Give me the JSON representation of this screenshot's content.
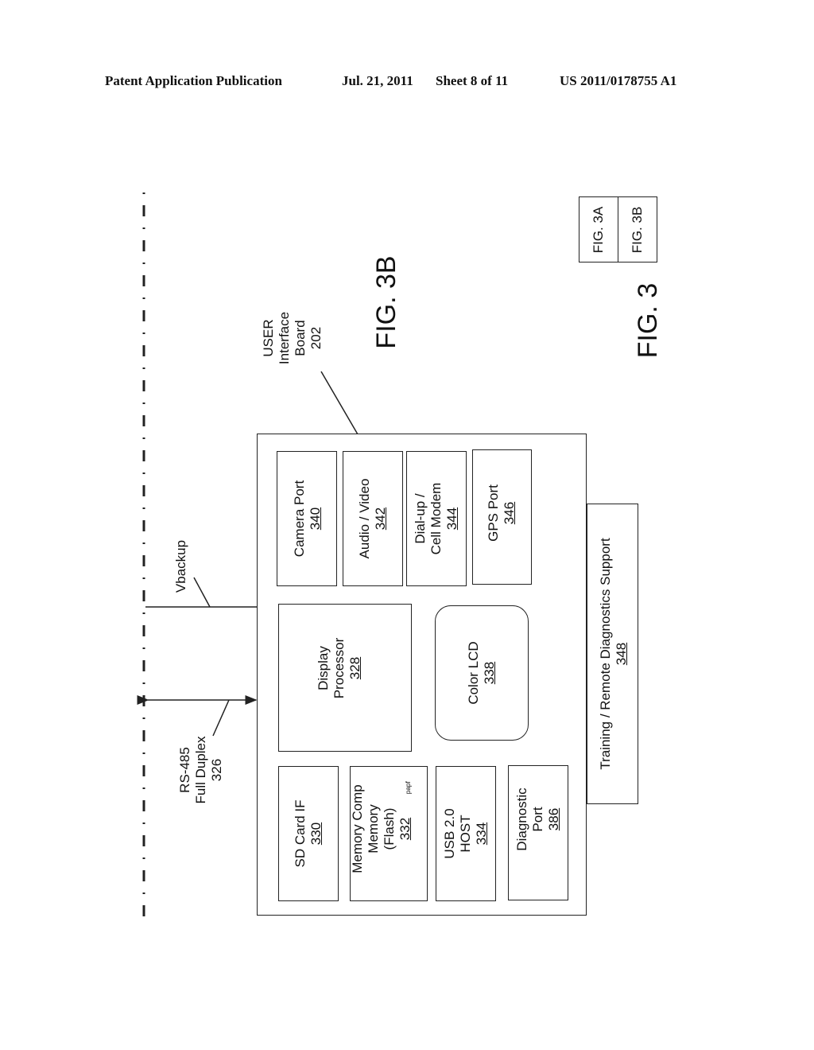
{
  "header": {
    "publication": "Patent Application Publication",
    "date": "Jul. 21, 2011",
    "sheet": "Sheet 8 of 11",
    "number": "US 2011/0178755 A1"
  },
  "figure": {
    "title": "FIG. 3B",
    "overall_title": "FIG. 3",
    "key": [
      "FIG. 3A",
      "FIG. 3B"
    ]
  },
  "board": {
    "label_lines": [
      "USER",
      "Interface",
      "Board",
      "202"
    ]
  },
  "signals": {
    "vbackup": "Vbackup",
    "rs485_lines": [
      "RS-485",
      "Full Duplex",
      "326"
    ]
  },
  "blocks": {
    "camera": {
      "name": "Camera Port",
      "ref": "340"
    },
    "audio": {
      "name": "Audio / Video",
      "ref": "342"
    },
    "modem": {
      "name1": "Dial-up /",
      "name2": "Cell Modem",
      "ref": "344"
    },
    "gps": {
      "name": "GPS Port",
      "ref": "346"
    },
    "display": {
      "name1": "Display",
      "name2": "Processor",
      "ref": "328"
    },
    "lcd": {
      "name": "Color LCD",
      "ref": "338"
    },
    "sd": {
      "name": "SD Card IF",
      "ref": "330"
    },
    "memory": {
      "name1": "Memory Comp",
      "name2": "Memory",
      "name3": "(Flash)",
      "ref": "332",
      "annotation": "ᵖᵃᵖᶠ"
    },
    "usb": {
      "name1": "USB 2.0",
      "name2": "HOST",
      "ref": "334"
    },
    "diag": {
      "name1": "Diagnostic",
      "name2": "Port",
      "ref": "386"
    },
    "training": {
      "name": "Training / Remote Diagnostics Support",
      "ref": "348"
    }
  }
}
